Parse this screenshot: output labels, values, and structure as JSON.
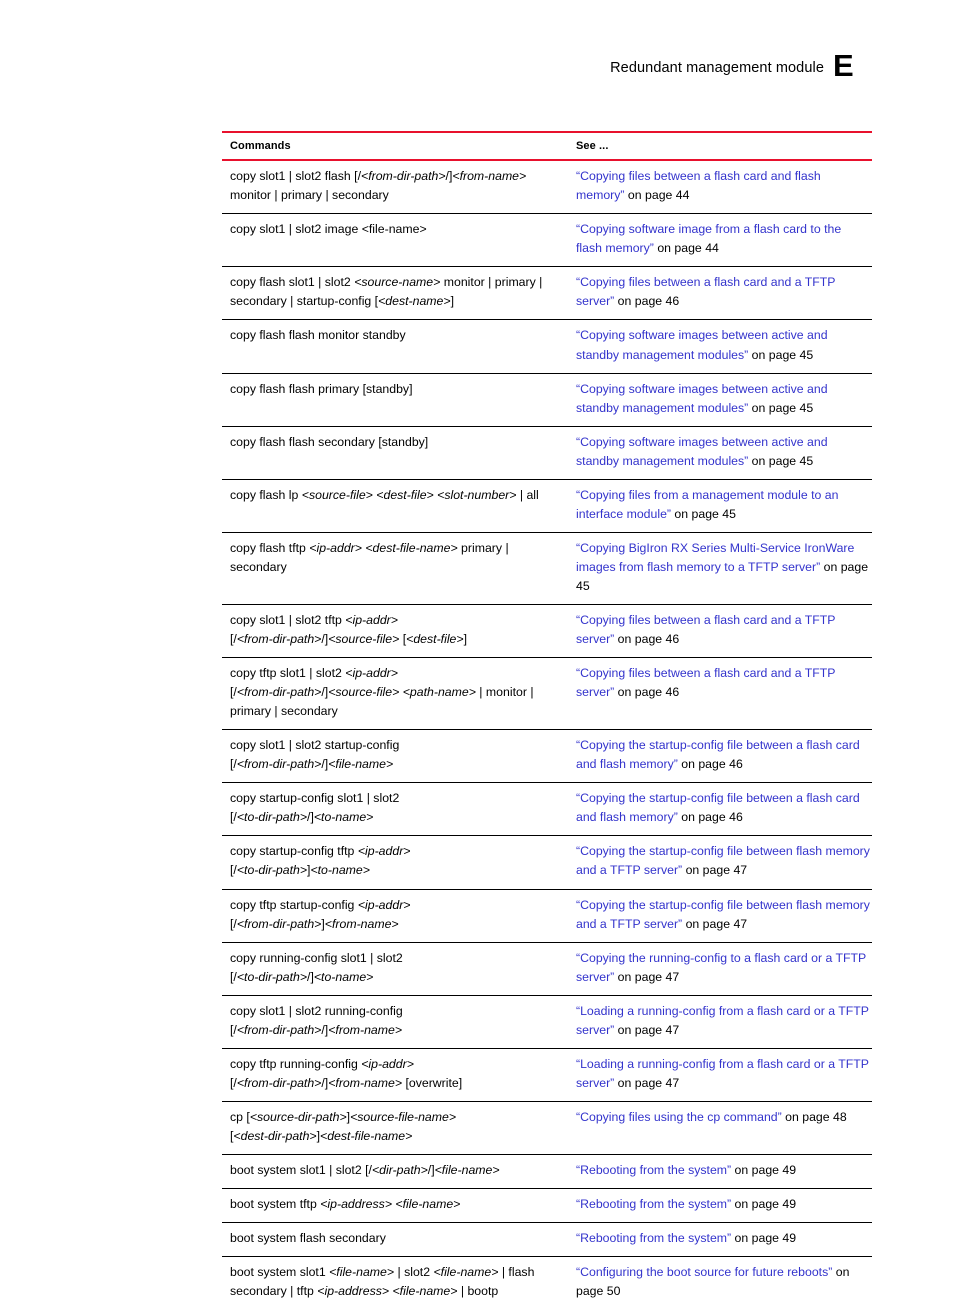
{
  "header": {
    "title": "Redundant management module",
    "chapter_letter": "E"
  },
  "table": {
    "columns": [
      "Commands",
      "See ..."
    ],
    "rows": [
      {
        "command_html": "copy slot1 | slot2 flash [/<i>&lt;from-dir-path&gt;</i>/]<i>&lt;from-name&gt;</i> monitor | primary | secondary",
        "link": "“Copying files between a flash card and flash memory”",
        "tail": " on page 44"
      },
      {
        "command_html": "copy slot1 | slot2 image &lt;file-name&gt;",
        "link": "“Copying software image from a flash card to the flash memory”",
        "tail": " on page 44"
      },
      {
        "command_html": "copy flash slot1 | slot2 <i>&lt;source-name&gt;</i> monitor | primary | secondary | startup-config [<i>&lt;dest-name&gt;</i>]",
        "link": "“Copying files between a flash card and a TFTP server”",
        "tail": " on page 46"
      },
      {
        "command_html": "copy flash flash monitor standby",
        "link": "“Copying software images between active and standby management modules”",
        "tail": " on page 45"
      },
      {
        "command_html": "copy flash flash primary [standby]",
        "link": "“Copying software images between active and standby management modules”",
        "tail": " on page 45"
      },
      {
        "command_html": "copy flash flash secondary [standby]",
        "link": "“Copying software images between active and standby management modules”",
        "tail": " on page 45"
      },
      {
        "command_html": "copy flash lp <i>&lt;source-file&gt;</i> <i>&lt;dest-file&gt;</i> <i>&lt;slot-number&gt;</i> | all",
        "link": "“Copying files from a management module to an interface module”",
        "tail": " on page 45"
      },
      {
        "command_html": "copy flash tftp <i>&lt;ip-addr&gt;</i> <i>&lt;dest-file-name&gt;</i> primary | secondary",
        "link": "“Copying BigIron RX Series Multi-Service IronWare images from flash memory to a TFTP server”",
        "tail": " on page 45"
      },
      {
        "command_html": "copy slot1 | slot2 tftp <i>&lt;ip-addr&gt;</i><br>[/<i>&lt;from-dir-path&gt;</i>/]<i>&lt;source-file&gt;</i> [<i>&lt;dest-file&gt;</i>]",
        "link": "“Copying files between a flash card and a TFTP server”",
        "tail": " on page 46"
      },
      {
        "command_html": "copy tftp slot1 | slot2 <i>&lt;ip-addr&gt;</i><br>[/<i>&lt;from-dir-path&gt;</i>/]<i>&lt;source-file&gt;</i> <i>&lt;path-name&gt;</i> | monitor | primary | secondary",
        "link": "“Copying files between a flash card and a TFTP server”",
        "tail": " on page 46"
      },
      {
        "command_html": "copy slot1 | slot2 startup-config<br>[/<i>&lt;from-dir-path&gt;</i>/]<i>&lt;file-name&gt;</i>",
        "link": "“Copying the startup-config file between a flash card and flash memory”",
        "tail": " on page 46"
      },
      {
        "command_html": "copy startup-config slot1 | slot2<br>[/<i>&lt;to-dir-path&gt;</i>/]<i>&lt;to-name&gt;</i>",
        "link": "“Copying the startup-config file between a flash card and flash memory”",
        "tail": " on page 46"
      },
      {
        "command_html": "copy startup-config tftp <i>&lt;ip-addr&gt;</i><br>[/<i>&lt;to-dir-path&gt;</i>]<i>&lt;to-name&gt;</i>",
        "link": "“Copying the startup-config file between flash memory and a TFTP server”",
        "tail": " on page 47"
      },
      {
        "command_html": "copy tftp startup-config <i>&lt;ip-addr&gt;</i><br>[/<i>&lt;from-dir-path&gt;</i>]<i>&lt;from-name&gt;</i>",
        "link": "“Copying the startup-config file between flash memory and a TFTP server”",
        "tail": " on page 47"
      },
      {
        "command_html": "copy running-config slot1 | slot2<br>[/<i>&lt;to-dir-path&gt;</i>/]<i>&lt;to-name&gt;</i>",
        "link": "“Copying the running-config to a flash card or a TFTP server”",
        "tail": " on page 47"
      },
      {
        "command_html": "copy slot1 | slot2 running-config<br>[/<i>&lt;from-dir-path&gt;</i>/]<i>&lt;from-name&gt;</i>",
        "link": "“Loading a running-config from a flash card or a TFTP server”",
        "tail": " on page 47"
      },
      {
        "command_html": "copy tftp running-config <i>&lt;ip-addr&gt;</i><br>[/<i>&lt;from-dir-path&gt;</i>/]<i>&lt;from-name&gt;</i> [overwrite]",
        "link": "“Loading a running-config from a flash card or a TFTP server”",
        "tail": " on page 47"
      },
      {
        "command_html": "cp [<i>&lt;source-dir-path&gt;</i>]<i>&lt;source-file-name&gt;</i><br>[<i>&lt;dest-dir-path&gt;</i>]<i>&lt;dest-file-name&gt;</i>",
        "link": "“Copying files using the cp command”",
        "tail": " on page 48"
      },
      {
        "command_html": "boot system slot1 | slot2 [/<i>&lt;dir-path&gt;</i>/]<i>&lt;file-name&gt;</i>",
        "link": "“Rebooting from the system”",
        "tail": " on page 49"
      },
      {
        "command_html": "boot system tftp <i>&lt;ip-address&gt;</i> <i>&lt;file-name&gt;</i>",
        "link": "“Rebooting from the system”",
        "tail": " on page 49"
      },
      {
        "command_html": "boot system flash secondary",
        "link": "“Rebooting from the system”",
        "tail": " on page 49"
      },
      {
        "command_html": "boot system slot1 <i>&lt;file-name&gt;</i> | slot2 <i>&lt;file-name&gt;</i> | flash secondary | tftp <i>&lt;ip-address&gt;</i> <i>&lt;file-name&gt;</i> | bootp",
        "link": "“Configuring the boot source for future reboots”",
        "tail": " on page 50"
      }
    ]
  },
  "colors": {
    "rule_accent": "#e8112d",
    "rule_body": "#000000",
    "link": "#3333cc",
    "text": "#000000"
  }
}
